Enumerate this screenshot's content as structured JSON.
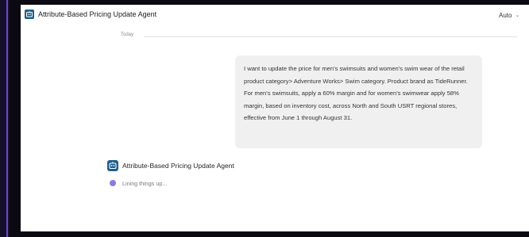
{
  "app": {
    "title": "Attribute-Based Pricing Update Agent",
    "icon": "agent-logo-icon"
  },
  "header": {
    "mode_label": "Auto",
    "mode_icon": "chevron-down-icon"
  },
  "conversation": {
    "date_separator": "Today",
    "user_message": "I want to update the price for men's swimsuits and women's swim wear of the retail product category> Adventure Works> Swim category. Product brand as TideRunner.  For men's swimsuits, apply a 60% margin and for women's swimwear apply 58% margin, based on inventory cost, across North and South USRT regional stores, effective from June 1 through August 31.",
    "agent": {
      "name": "Attribute-Based Pricing Update Agent",
      "icon": "agent-logo-icon"
    },
    "status": {
      "text": "Lining things up...",
      "dot_color": "#8b7be0"
    }
  },
  "colors": {
    "accent": "#6a47d8",
    "agent_icon_bg": "#1f5f8a",
    "bubble_bg": "#f0f0f0"
  }
}
